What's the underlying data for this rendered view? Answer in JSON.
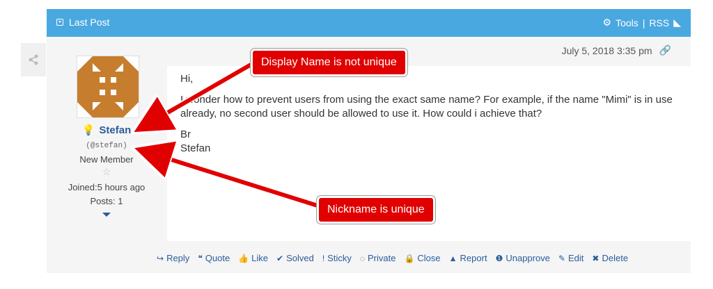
{
  "header": {
    "title": "Last Post",
    "tools": "Tools",
    "separator": "|",
    "rss": "RSS"
  },
  "post": {
    "date": "July 5, 2018 3:35 pm",
    "author": {
      "name": "Stefan",
      "nickname": "(@stefan)",
      "rank": "New Member",
      "joined": "Joined:5 hours  ago",
      "posts": "Posts: 1"
    },
    "content": {
      "line1": "Hi,",
      "line2": "I wonder how to prevent users from using the exact same name? For example, if the name \"Mimi\" is in use already, no second user should be allowed to use it. How could i achieve that?",
      "line3": "Br",
      "line4": "Stefan"
    },
    "actions": [
      {
        "icon": "reply-icon",
        "glyph": "↪",
        "label": "Reply"
      },
      {
        "icon": "quote-icon",
        "glyph": "❝",
        "label": "Quote"
      },
      {
        "icon": "like-icon",
        "glyph": "👍",
        "label": "Like"
      },
      {
        "icon": "check-circle-icon",
        "glyph": "✔",
        "label": "Solved"
      },
      {
        "icon": "exclamation-icon",
        "glyph": "!",
        "label": "Sticky"
      },
      {
        "icon": "eye-slash-icon",
        "glyph": "◌",
        "label": "Private"
      },
      {
        "icon": "lock-icon",
        "glyph": "🔒",
        "label": "Close"
      },
      {
        "icon": "warning-icon",
        "glyph": "▲",
        "label": "Report"
      },
      {
        "icon": "info-icon",
        "glyph": "❶",
        "label": "Unapprove"
      },
      {
        "icon": "edit-icon",
        "glyph": "✎",
        "label": "Edit"
      },
      {
        "icon": "delete-icon",
        "glyph": "✖",
        "label": "Delete"
      }
    ]
  },
  "annotations": {
    "display_name": "Display Name is not unique",
    "nickname": "Nickname is unique"
  },
  "colors": {
    "header": "#4aa8e0",
    "link": "#2a5c9a",
    "callout": "#e10000"
  }
}
